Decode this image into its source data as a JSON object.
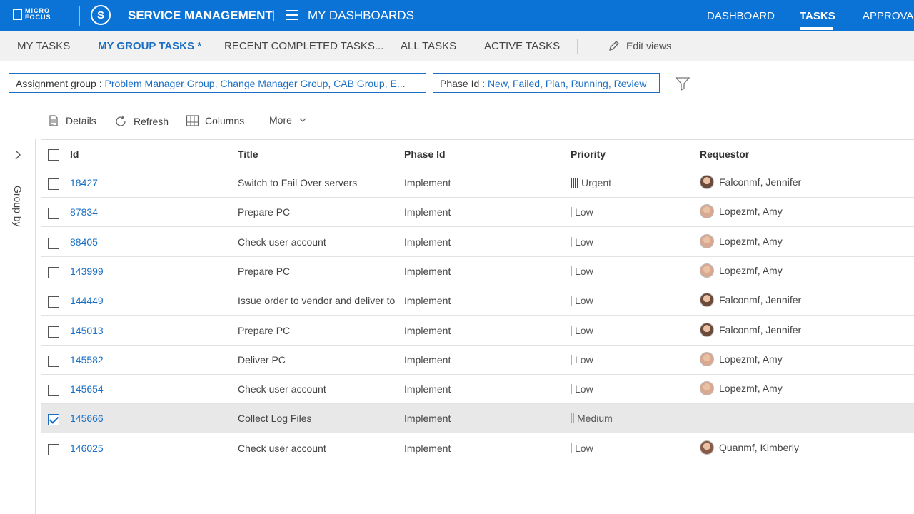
{
  "colors": {
    "brand_blue": "#0b73d6",
    "link_blue": "#1a6fc4",
    "urgent": "#c8102e",
    "low": "#f0b400",
    "medium": "#f29d2a"
  },
  "topbar": {
    "logo_line1": "MICRO",
    "logo_line2": "FOCUS",
    "s_logo": "S",
    "app_title": "SERVICE MANAGEMENT",
    "separator": "|",
    "dashboards_title": "MY DASHBOARDS",
    "nav": {
      "dashboard": "DASHBOARD",
      "tasks": "TASKS",
      "approvals": "APPROVAL"
    }
  },
  "tabs": {
    "my_tasks": "MY TASKS",
    "my_group_tasks": "MY GROUP TASKS *",
    "recent_completed": "RECENT COMPLETED TASKS...",
    "all_tasks": "ALL TASKS",
    "active_tasks": "ACTIVE TASKS",
    "edit_views": "Edit views"
  },
  "filters": {
    "assignment_label": "Assignment group :",
    "assignment_value": "Problem Manager Group, Change Manager Group, CAB Group, E...",
    "phase_label": "Phase Id :",
    "phase_value": "New, Failed, Plan, Running, Review"
  },
  "toolbar": {
    "details": "Details",
    "refresh": "Refresh",
    "columns": "Columns",
    "more": "More"
  },
  "groupby": {
    "label": "Group by"
  },
  "table": {
    "headers": {
      "id": "Id",
      "title": "Title",
      "phase": "Phase Id",
      "priority": "Priority",
      "requestor": "Requestor"
    },
    "rows": [
      {
        "id": "18427",
        "title": "Switch to Fail Over servers",
        "phase": "Implement",
        "priority": "Urgent",
        "requestor": "Falconmf, Jennifer"
      },
      {
        "id": "87834",
        "title": "Prepare PC",
        "phase": "Implement",
        "priority": "Low",
        "requestor": "Lopezmf, Amy"
      },
      {
        "id": "88405",
        "title": "Check user account",
        "phase": "Implement",
        "priority": "Low",
        "requestor": "Lopezmf, Amy"
      },
      {
        "id": "143999",
        "title": "Prepare PC",
        "phase": "Implement",
        "priority": "Low",
        "requestor": "Lopezmf, Amy"
      },
      {
        "id": "144449",
        "title": "Issue order to vendor and deliver to",
        "phase": "Implement",
        "priority": "Low",
        "requestor": "Falconmf, Jennifer"
      },
      {
        "id": "145013",
        "title": "Prepare PC",
        "phase": "Implement",
        "priority": "Low",
        "requestor": "Falconmf, Jennifer"
      },
      {
        "id": "145582",
        "title": "Deliver PC",
        "phase": "Implement",
        "priority": "Low",
        "requestor": "Lopezmf, Amy"
      },
      {
        "id": "145654",
        "title": "Check user account",
        "phase": "Implement",
        "priority": "Low",
        "requestor": "Lopezmf, Amy"
      },
      {
        "id": "145666",
        "title": "Collect Log Files",
        "phase": "Implement",
        "priority": "Medium",
        "requestor": ""
      },
      {
        "id": "146025",
        "title": "Check user account",
        "phase": "Implement",
        "priority": "Low",
        "requestor": "Quanmf, Kimberly"
      }
    ]
  }
}
